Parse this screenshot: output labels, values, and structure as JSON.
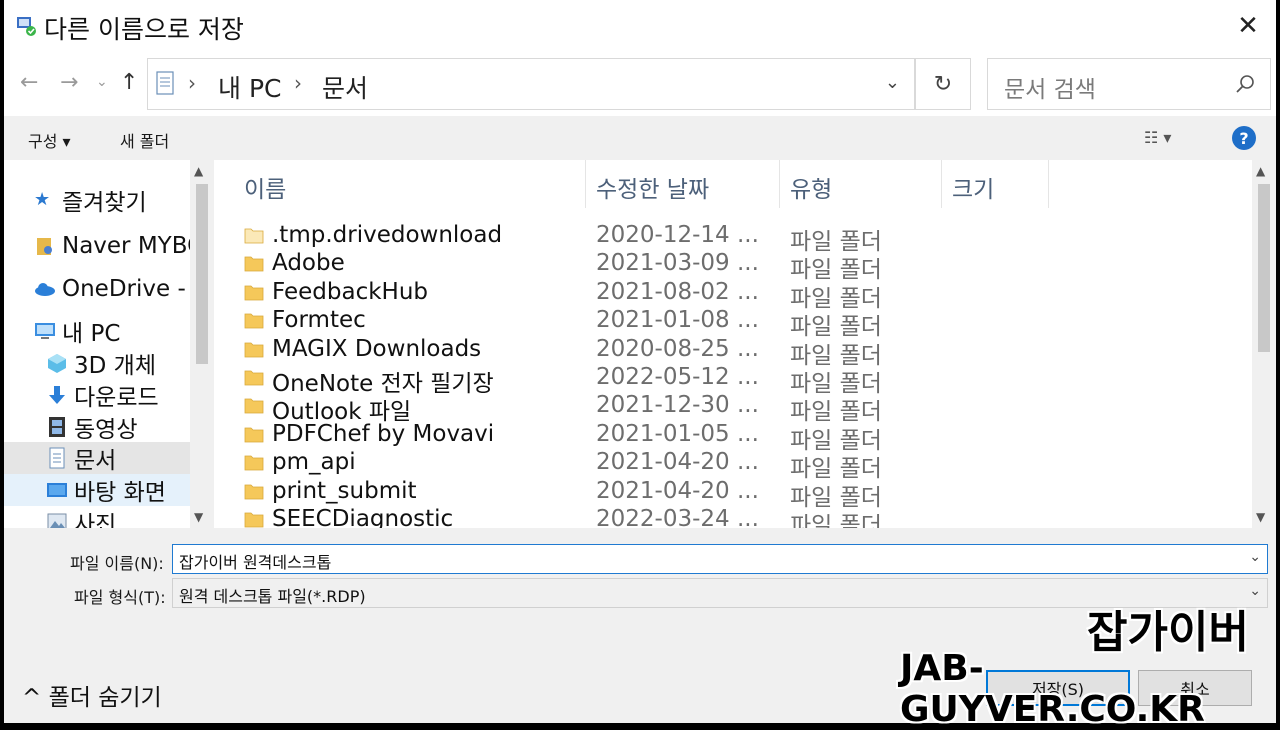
{
  "window": {
    "title": "다른 이름으로 저장",
    "close": "✕"
  },
  "nav": {
    "back": "←",
    "forward": "→",
    "recent": "⌄",
    "up": "↑",
    "breadcrumb": [
      "내 PC",
      "문서"
    ],
    "refresh": "↻",
    "search_placeholder": "문서 검색"
  },
  "toolbar": {
    "organize": "구성 ▾",
    "new_folder": "새 폴더",
    "view": "☷ ▾",
    "help": "?"
  },
  "sidebar": {
    "items": [
      {
        "label": "즐겨찾기",
        "icon": "star-icon"
      },
      {
        "label": "Naver MYBOX",
        "icon": "mybox-icon"
      },
      {
        "label": "OneDrive - Personal",
        "icon": "cloud-icon"
      },
      {
        "label": "내 PC",
        "icon": "computer-icon"
      },
      {
        "label": "3D 개체",
        "icon": "cube-icon"
      },
      {
        "label": "다운로드",
        "icon": "download-icon"
      },
      {
        "label": "동영상",
        "icon": "film-icon"
      },
      {
        "label": "문서",
        "icon": "document-icon",
        "selected": true
      },
      {
        "label": "바탕 화면",
        "icon": "desktop-icon"
      },
      {
        "label": "사진",
        "icon": "picture-icon"
      }
    ]
  },
  "columns": {
    "name": "이름",
    "date": "수정한 날짜",
    "type": "유형",
    "size": "크기",
    "sort_indicator": "^"
  },
  "files": [
    {
      "name": ".tmp.drivedownload",
      "date": "2020-12-14 ...",
      "type": "파일 폴더",
      "hidden": true
    },
    {
      "name": "Adobe",
      "date": "2021-03-09 ...",
      "type": "파일 폴더"
    },
    {
      "name": "FeedbackHub",
      "date": "2021-08-02 ...",
      "type": "파일 폴더"
    },
    {
      "name": "Formtec",
      "date": "2021-01-08 ...",
      "type": "파일 폴더"
    },
    {
      "name": "MAGIX Downloads",
      "date": "2020-08-25 ...",
      "type": "파일 폴더"
    },
    {
      "name": "OneNote 전자 필기장",
      "date": "2022-05-12 ...",
      "type": "파일 폴더"
    },
    {
      "name": "Outlook 파일",
      "date": "2021-12-30 ...",
      "type": "파일 폴더"
    },
    {
      "name": "PDFChef by Movavi",
      "date": "2021-01-05 ...",
      "type": "파일 폴더"
    },
    {
      "name": "pm_api",
      "date": "2021-04-20 ...",
      "type": "파일 폴더"
    },
    {
      "name": "print_submit",
      "date": "2021-04-20 ...",
      "type": "파일 폴더"
    },
    {
      "name": "SEECDiagnostic",
      "date": "2022-03-24 ...",
      "type": "파일 폴더"
    }
  ],
  "form": {
    "filename_label": "파일 이름(N):",
    "filename_value": "잡가이버 원격데스크톱",
    "filetype_label": "파일 형식(T):",
    "filetype_value": "원격 데스크톱 파일(*.RDP)"
  },
  "footer": {
    "hide_folders": "^ 폴더 숨기기",
    "save": "저장(S)",
    "cancel": "취소"
  },
  "watermark": {
    "line1": "잡가이버",
    "line2": "JAB-GUYVER.CO.KR"
  },
  "colors": {
    "accent": "#0078d7",
    "folder": "#f5c85a",
    "selected_bg": "#e5e5e5",
    "help": "#1e6ec8"
  }
}
